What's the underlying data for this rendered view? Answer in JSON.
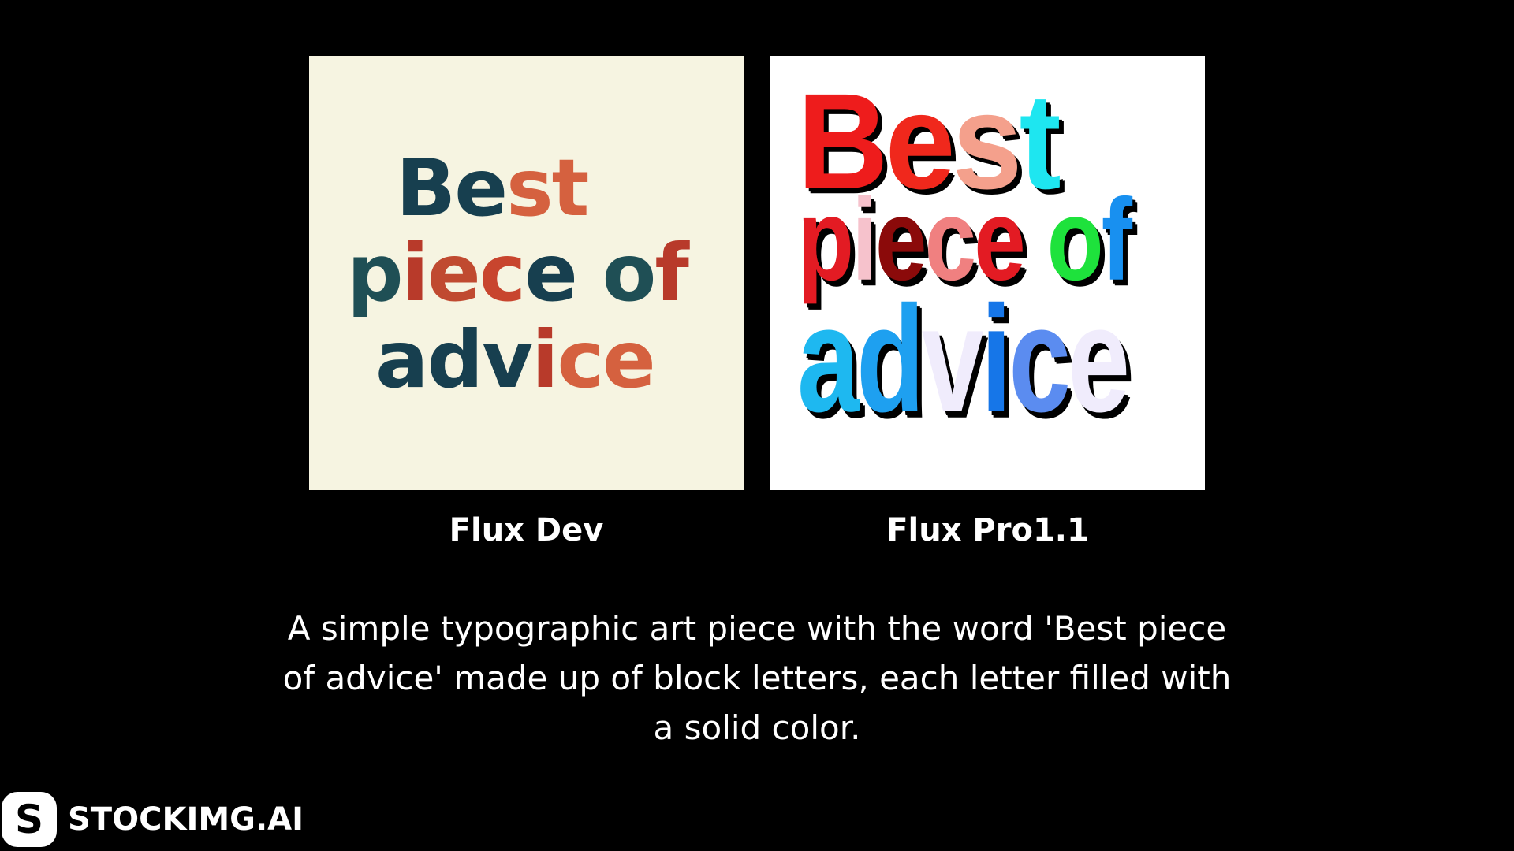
{
  "images": [
    {
      "caption": "Flux Dev",
      "artwork_lines": [
        [
          {
            "t": "B",
            "c": "#173f4f"
          },
          {
            "t": "e",
            "c": "#173f4f"
          },
          {
            "t": "s",
            "c": "#d5613f"
          },
          {
            "t": "t",
            "c": "#d5613f"
          }
        ],
        [
          {
            "t": "p",
            "c": "#1f4f55"
          },
          {
            "t": "i",
            "c": "#b83a2a"
          },
          {
            "t": "e",
            "c": "#c04a30"
          },
          {
            "t": "c",
            "c": "#c8452e"
          },
          {
            "t": "e",
            "c": "#173f4f"
          },
          {
            "t": " ",
            "c": "#173f4f"
          },
          {
            "t": "o",
            "c": "#1f4f55"
          },
          {
            "t": "f",
            "c": "#b83a2a"
          }
        ],
        [
          {
            "t": "a",
            "c": "#173f4f"
          },
          {
            "t": "d",
            "c": "#173f4f"
          },
          {
            "t": "v",
            "c": "#173f4f"
          },
          {
            "t": "i",
            "c": "#b83a2a"
          },
          {
            "t": "c",
            "c": "#d5613f"
          },
          {
            "t": "e",
            "c": "#d5613f"
          }
        ]
      ]
    },
    {
      "caption": "Flux Pro1.1",
      "artwork_lines": [
        [
          {
            "t": "B",
            "c": "#ee1c1c"
          },
          {
            "t": "e",
            "c": "#f0281c"
          },
          {
            "t": "s",
            "c": "#f4a08c"
          },
          {
            "t": "t",
            "c": "#1ee6f0"
          }
        ],
        [
          {
            "t": "p",
            "c": "#e31b23"
          },
          {
            "t": "i",
            "c": "#f6c2cc"
          },
          {
            "t": "e",
            "c": "#8b0a0a"
          },
          {
            "t": "c",
            "c": "#f08080"
          },
          {
            "t": "e",
            "c": "#e31b23"
          },
          {
            "t": " ",
            "c": "#ffffff"
          },
          {
            "t": "o",
            "c": "#1ee23c"
          },
          {
            "t": "f",
            "c": "#1890f0"
          }
        ],
        [
          {
            "t": "a",
            "c": "#1eb8f0"
          },
          {
            "t": "d",
            "c": "#1ea0f0"
          },
          {
            "t": "v",
            "c": "#f0ecfc"
          },
          {
            "t": "i",
            "c": "#1676e8"
          },
          {
            "t": "c",
            "c": "#5b8cf0"
          },
          {
            "t": "e",
            "c": "#f0ecfc"
          }
        ]
      ]
    }
  ],
  "prompt_lines": [
    "A simple typographic art piece with the word 'Best piece",
    "of advice' made up of block letters, each letter filled with",
    "a solid color."
  ],
  "brand": {
    "logo_letter": "S",
    "name": "STOCKIMG.AI"
  }
}
